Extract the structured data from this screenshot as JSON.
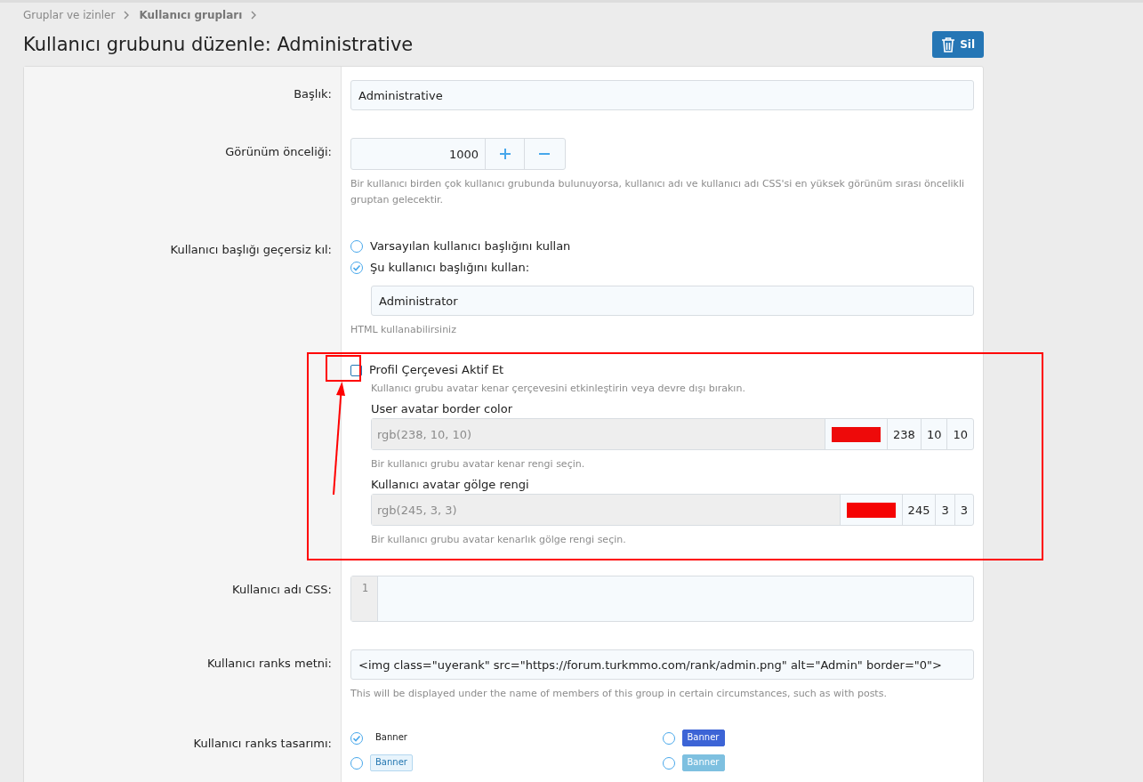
{
  "breadcrumb": [
    {
      "label": "Gruplar ve izinler",
      "current": false
    },
    {
      "label": "Kullanıcı grupları",
      "current": true
    }
  ],
  "page_title": "Kullanıcı grubunu düzenle: Administrative",
  "delete_button": "Sil",
  "title_field": {
    "label": "Başlık:",
    "value": "Administrative"
  },
  "display_order": {
    "label": "Görünüm önceliği:",
    "value": "1000",
    "hint": "Bir kullanıcı birden çok kullanıcı grubunda bulunuyorsa, kullanıcı adı ve kullanıcı adı CSS'si en yüksek görünüm sırası öncelikli gruptan gelecektir."
  },
  "user_title": {
    "label": "Kullanıcı başlığı geçersiz kıl:",
    "options": [
      {
        "label": "Varsayılan kullanıcı başlığını kullan",
        "selected": false
      },
      {
        "label": "Şu kullanıcı başlığını kullan:",
        "selected": true
      }
    ],
    "value": "Administrator",
    "hint": "HTML kullanabilirsiniz"
  },
  "profile_frame": {
    "label": "Profil Çerçevesi Aktif Et",
    "checked": false,
    "hint": "Kullanıcı grubu avatar kenar çerçevesini etkinleştirin veya devre dışı bırakın.",
    "colors": [
      {
        "label": "User avatar border color",
        "value": "rgb(238, 10, 10)",
        "disabled": true,
        "color": "#ee0a0a",
        "channels": [
          "238",
          "10",
          "10"
        ],
        "hint": "Bir kullanıcı grubu avatar kenar rengi seçin."
      },
      {
        "label": "Kullanıcı avatar gölge rengi",
        "value": "rgb(245, 3, 3)",
        "disabled": true,
        "color": "#f50303",
        "channels": [
          "245",
          "3",
          "3"
        ],
        "hint": "Bir kullanıcı grubu avatar kenarlık gölge rengi seçin."
      }
    ]
  },
  "css": {
    "label": "Kullanıcı adı CSS:",
    "line_number": "1"
  },
  "rank_text": {
    "label": "Kullanıcı ranks metni:",
    "value": "<img class=\"uyerank\" src=\"https://forum.turkmmo.com/rank/admin.png\" alt=\"Admin\" border=\"0\">",
    "hint": "This will be displayed under the name of members of this group in certain circumstances, such as with posts."
  },
  "rank_style": {
    "label": "Kullanıcı ranks tasarımı:",
    "options": [
      {
        "label": "Banner",
        "kind": "plain",
        "color": "#ffffff",
        "selected": true
      },
      {
        "label": "Banner",
        "kind": "solid",
        "color": "#3c64d6",
        "selected": false
      },
      {
        "label": "Banner",
        "kind": "light",
        "color": "#e8f4fc",
        "selected": false
      },
      {
        "label": "Banner",
        "kind": "solid",
        "color": "#7ec0e0",
        "selected": false
      }
    ]
  }
}
